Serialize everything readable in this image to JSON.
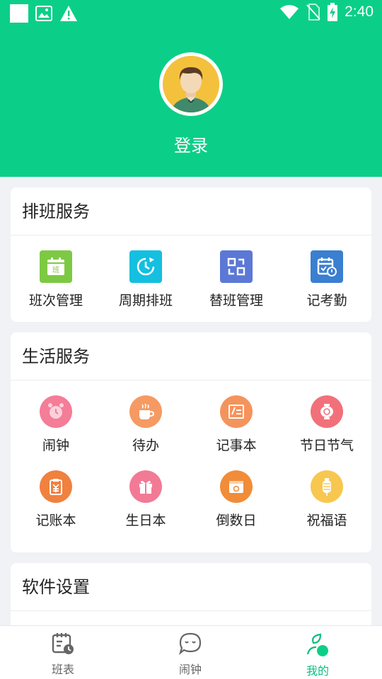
{
  "status_bar": {
    "time": "2:40"
  },
  "profile": {
    "login_label": "登录",
    "avatar_icon": "user-avatar-icon"
  },
  "sections": [
    {
      "title": "排班服务",
      "items": [
        {
          "label": "班次管理",
          "icon": "calendar-shift-icon",
          "color": "#7dc943",
          "glyph": "班"
        },
        {
          "label": "周期排班",
          "icon": "cycle-clock-icon",
          "color": "#14bfe0"
        },
        {
          "label": "替班管理",
          "icon": "swap-icon",
          "color": "#5b78d6"
        },
        {
          "label": "记考勤",
          "icon": "attendance-calendar-icon",
          "color": "#3a7fd0"
        }
      ]
    },
    {
      "title": "生活服务",
      "items": [
        {
          "label": "闹钟",
          "icon": "alarm-clock-icon",
          "color": "#f47d98"
        },
        {
          "label": "待办",
          "icon": "coffee-cup-icon",
          "color": "#f59a62"
        },
        {
          "label": "记事本",
          "icon": "notepad-icon",
          "color": "#f5935c"
        },
        {
          "label": "节日节气",
          "icon": "lantern-festival-icon",
          "color": "#f2707a"
        },
        {
          "label": "记账本",
          "icon": "yuan-clipboard-icon",
          "color": "#f0813f"
        },
        {
          "label": "生日本",
          "icon": "gift-icon",
          "color": "#f27a95"
        },
        {
          "label": "倒数日",
          "icon": "countdown-calendar-icon",
          "color": "#f18c39"
        },
        {
          "label": "祝福语",
          "icon": "lantern-icon",
          "color": "#f7c74f"
        }
      ]
    },
    {
      "title": "软件设置"
    }
  ],
  "bottom_nav": [
    {
      "label": "班表",
      "icon": "schedule-icon",
      "active": false
    },
    {
      "label": "闹钟",
      "icon": "chat-clock-icon",
      "active": false
    },
    {
      "label": "我的",
      "icon": "profile-leaf-icon",
      "active": true
    }
  ],
  "colors": {
    "brand_green": "#0bcf88",
    "active_nav": "#0bbf7e"
  }
}
